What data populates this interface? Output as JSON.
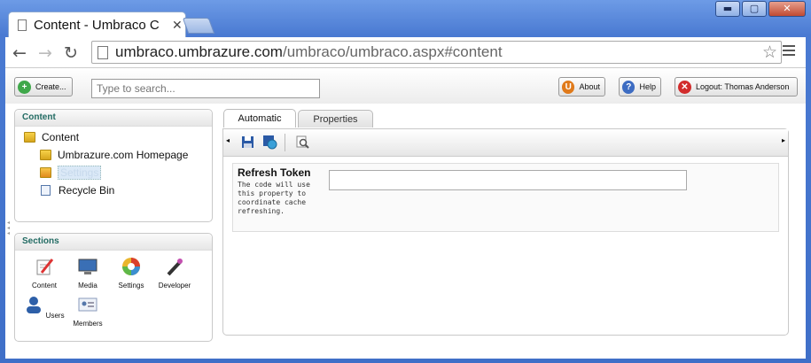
{
  "window": {
    "tab_title": "Content - Umbraco C",
    "url_domain": "umbraco.umbrazure.com",
    "url_path": "/umbraco/umbraco.aspx#content",
    "controls": {
      "min": "▬",
      "max": "▢",
      "close": "✕"
    }
  },
  "nav": {
    "back": "←",
    "forward": "→",
    "reload": "↻"
  },
  "topbar": {
    "create_label": "Create...",
    "search_placeholder": "Type to search...",
    "about_label": "About",
    "help_label": "Help",
    "logout_label": "Logout: Thomas Anderson"
  },
  "content_panel": {
    "header": "Content",
    "tree": [
      {
        "label": "Content",
        "icon": "folder-icon"
      },
      {
        "label": "Umbrazure.com Homepage",
        "icon": "folder-icon"
      },
      {
        "label": "Settings",
        "icon": "folder-settings-icon",
        "selected": true
      },
      {
        "label": "Recycle Bin",
        "icon": "recycle-bin-icon"
      }
    ]
  },
  "sections_panel": {
    "header": "Sections",
    "items": [
      {
        "label": "Content",
        "icon": "content-pencil-icon"
      },
      {
        "label": "Media",
        "icon": "media-monitor-icon"
      },
      {
        "label": "Settings",
        "icon": "settings-color-wheel-icon"
      },
      {
        "label": "Developer",
        "icon": "developer-wand-icon"
      },
      {
        "label": "Users",
        "icon": "users-person-icon"
      },
      {
        "label": "Members",
        "icon": "members-card-icon"
      }
    ]
  },
  "editor": {
    "tabs": [
      "Automatic",
      "Properties"
    ],
    "active_tab": "Automatic",
    "field": {
      "label": "Refresh Token",
      "description": "The code will use this property to coordinate cache refreshing.",
      "value": ""
    }
  },
  "colors": {
    "accent_green": "#226b63",
    "chrome_blue": "#4a7ad2"
  }
}
